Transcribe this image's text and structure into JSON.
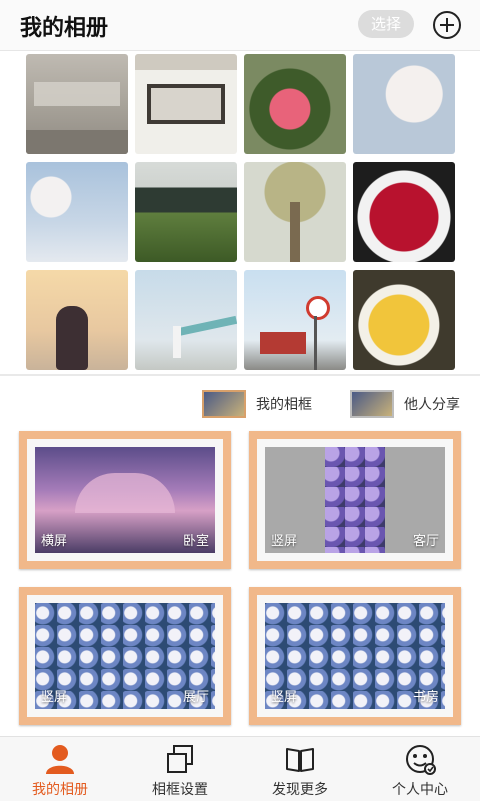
{
  "header": {
    "title": "我的相册",
    "select_label": "选择"
  },
  "photos": [
    {
      "name": "photo-stone-inscription"
    },
    {
      "name": "photo-gate-plaque"
    },
    {
      "name": "photo-camellia"
    },
    {
      "name": "photo-cherry-blossom"
    },
    {
      "name": "photo-blossom-pier"
    },
    {
      "name": "photo-forest-meadow"
    },
    {
      "name": "photo-tall-tree"
    },
    {
      "name": "photo-raspberries"
    },
    {
      "name": "photo-sunset-girl"
    },
    {
      "name": "photo-scarf-beach"
    },
    {
      "name": "photo-train-sign"
    },
    {
      "name": "photo-food-plate"
    }
  ],
  "tabs": {
    "mine": "我的相框",
    "shared": "他人分享"
  },
  "frames": [
    {
      "orientation": "横屏",
      "room": "卧室"
    },
    {
      "orientation": "竖屏",
      "room": "客厅"
    },
    {
      "orientation": "竖屏",
      "room": "展厅"
    },
    {
      "orientation": "竖屏",
      "room": "书房"
    }
  ],
  "nav": [
    {
      "label": "我的相册",
      "icon": "person-icon",
      "active": true
    },
    {
      "label": "相框设置",
      "icon": "frames-icon",
      "active": false
    },
    {
      "label": "发现更多",
      "icon": "book-icon",
      "active": false
    },
    {
      "label": "个人中心",
      "icon": "user-center-icon",
      "active": false
    }
  ],
  "colors": {
    "accent": "#e35b1f",
    "frame_wood": "#f1b88a"
  }
}
